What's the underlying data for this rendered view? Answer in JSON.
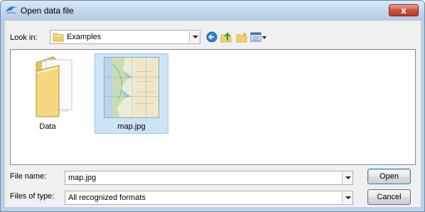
{
  "window": {
    "title": "Open data file",
    "close_label": "x"
  },
  "toolbar": {
    "look_in_label": "Look in:",
    "look_in_value": "Examples",
    "icons": [
      "back-icon",
      "up-folder-icon",
      "new-folder-icon",
      "view-menu-icon"
    ]
  },
  "files": [
    {
      "name": "Data",
      "type": "folder",
      "selected": false
    },
    {
      "name": "map.jpg",
      "type": "image",
      "selected": true
    }
  ],
  "form": {
    "file_name_label": "File name:",
    "file_name_value": "map.jpg",
    "files_of_type_label": "Files of type:",
    "files_of_type_value": "All recognized formats"
  },
  "buttons": {
    "open": "Open",
    "cancel": "Cancel"
  },
  "colors": {
    "selection": "#cce4f7",
    "title_bar": "#c2d6ec",
    "close": "#d0503c",
    "dialog": "#f0f0f0"
  }
}
